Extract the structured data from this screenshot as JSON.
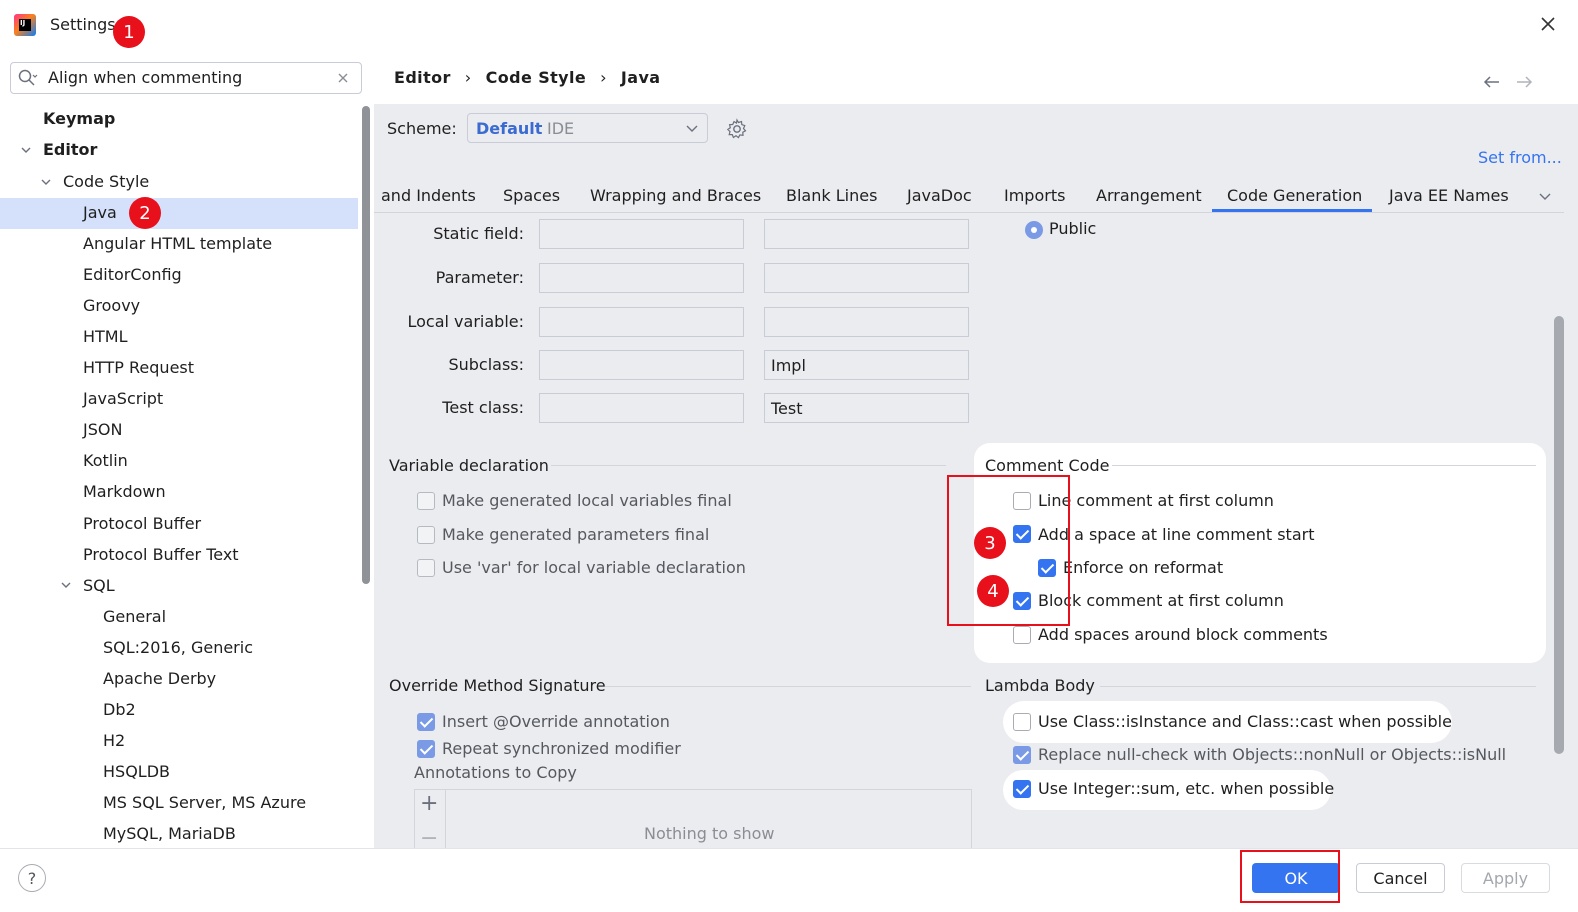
{
  "window": {
    "title": "Settings"
  },
  "badges": [
    "1",
    "2",
    "3",
    "4"
  ],
  "search": {
    "value": "Align when commenting"
  },
  "tree": {
    "items": [
      {
        "label": "Keymap"
      },
      {
        "label": "Editor"
      },
      {
        "label": "Code Style"
      },
      {
        "label": "Java"
      },
      {
        "label": "Angular HTML template"
      },
      {
        "label": "EditorConfig"
      },
      {
        "label": "Groovy"
      },
      {
        "label": "HTML"
      },
      {
        "label": "HTTP Request"
      },
      {
        "label": "JavaScript"
      },
      {
        "label": "JSON"
      },
      {
        "label": "Kotlin"
      },
      {
        "label": "Markdown"
      },
      {
        "label": "Protocol Buffer"
      },
      {
        "label": "Protocol Buffer Text"
      },
      {
        "label": "SQL"
      },
      {
        "label": "General"
      },
      {
        "label": "SQL:2016, Generic"
      },
      {
        "label": "Apache Derby"
      },
      {
        "label": "Db2"
      },
      {
        "label": "H2"
      },
      {
        "label": "HSQLDB"
      },
      {
        "label": "MS SQL Server, MS Azure"
      },
      {
        "label": "MySQL, MariaDB"
      }
    ]
  },
  "breadcrumb": {
    "part1": "Editor",
    "part2": "Code Style",
    "part3": "Java",
    "sep": "›"
  },
  "scheme": {
    "label": "Scheme:",
    "value": "Default",
    "sub": "IDE",
    "set_from": "Set from..."
  },
  "tabs": [
    "and Indents",
    "Spaces",
    "Wrapping and Braces",
    "Blank Lines",
    "JavaDoc",
    "Imports",
    "Arrangement",
    "Code Generation",
    "Java EE Names"
  ],
  "naming": {
    "rows": [
      {
        "label": "Static field:",
        "prefix": "",
        "suffix": ""
      },
      {
        "label": "Parameter:",
        "prefix": "",
        "suffix": ""
      },
      {
        "label": "Local variable:",
        "prefix": "",
        "suffix": ""
      },
      {
        "label": "Subclass:",
        "prefix": "",
        "suffix": "Impl"
      },
      {
        "label": "Test class:",
        "prefix": "",
        "suffix": "Test"
      }
    ]
  },
  "visibility": {
    "public_label": "Public"
  },
  "variable_declaration": {
    "title": "Variable declaration",
    "options": [
      {
        "label": "Make generated local variables final",
        "checked": false
      },
      {
        "label": "Make generated parameters final",
        "checked": false
      },
      {
        "label": "Use 'var' for local variable declaration",
        "checked": false
      }
    ]
  },
  "comment_code": {
    "title": "Comment Code",
    "options": [
      {
        "label": "Line comment at first column",
        "checked": false
      },
      {
        "label": "Add a space at line comment start",
        "checked": true
      },
      {
        "label": "Enforce on reformat",
        "checked": true
      },
      {
        "label": "Block comment at first column",
        "checked": true
      },
      {
        "label": "Add spaces around block comments",
        "checked": false
      }
    ]
  },
  "override": {
    "title": "Override Method Signature",
    "options": [
      {
        "label": "Insert @Override annotation",
        "checked": true
      },
      {
        "label": "Repeat synchronized modifier",
        "checked": true
      }
    ],
    "annotations_label": "Annotations to Copy",
    "empty_text": "Nothing to show"
  },
  "lambda": {
    "title": "Lambda Body",
    "options": [
      {
        "label": "Use Class::isInstance and Class::cast when possible",
        "checked": false
      },
      {
        "label": "Replace null-check with Objects::nonNull or Objects::isNull",
        "checked": true
      },
      {
        "label": "Use Integer::sum, etc. when possible",
        "checked": true
      }
    ]
  },
  "buttons": {
    "help": "?",
    "ok": "OK",
    "cancel": "Cancel",
    "apply": "Apply"
  },
  "colors": {
    "accent": "#3574f0",
    "annotation_red": "#e8101a",
    "selection": "#d5e1fa"
  }
}
